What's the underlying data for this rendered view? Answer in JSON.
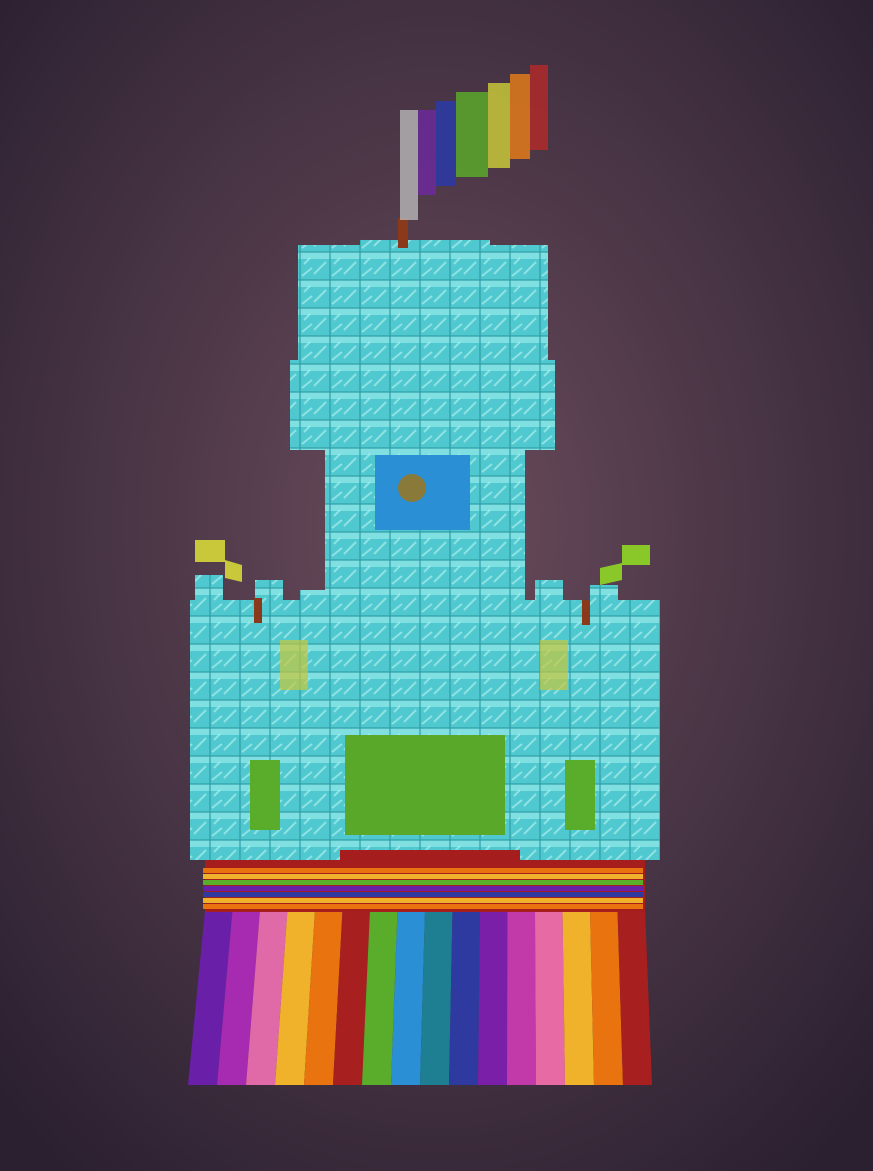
{
  "scene": {
    "subject": "castle-build",
    "colors": {
      "background_center": "#6b4c5c",
      "background_edge": "#2a2030",
      "block_top": "#8fe6e6",
      "block_face": "#4fc9cf",
      "block_dark": "#2f9ea6",
      "block_line": "#b9f3f1",
      "base_red": "#a51d1d",
      "flag_pole": "#b8b8b8",
      "pole_post": "#8a3a1a",
      "rainbow": [
        "#6a1fa8",
        "#a62bb0",
        "#e06aa8",
        "#f0b22a",
        "#e8730f",
        "#a81f1f",
        "#5aad2a",
        "#2a8fd4",
        "#1e7f93",
        "#2e3aa0",
        "#7a1fa8",
        "#c23aaa",
        "#e86aa4",
        "#f0b22a",
        "#e8730f",
        "#a81f1f"
      ],
      "flag_stripes": [
        "#6b2a9a",
        "#2a3aa6",
        "#5aa82a",
        "#c8c83a",
        "#e07a1a",
        "#b02a2a"
      ],
      "side_flags": [
        "#c8c83a",
        "#8ac82a"
      ]
    }
  }
}
